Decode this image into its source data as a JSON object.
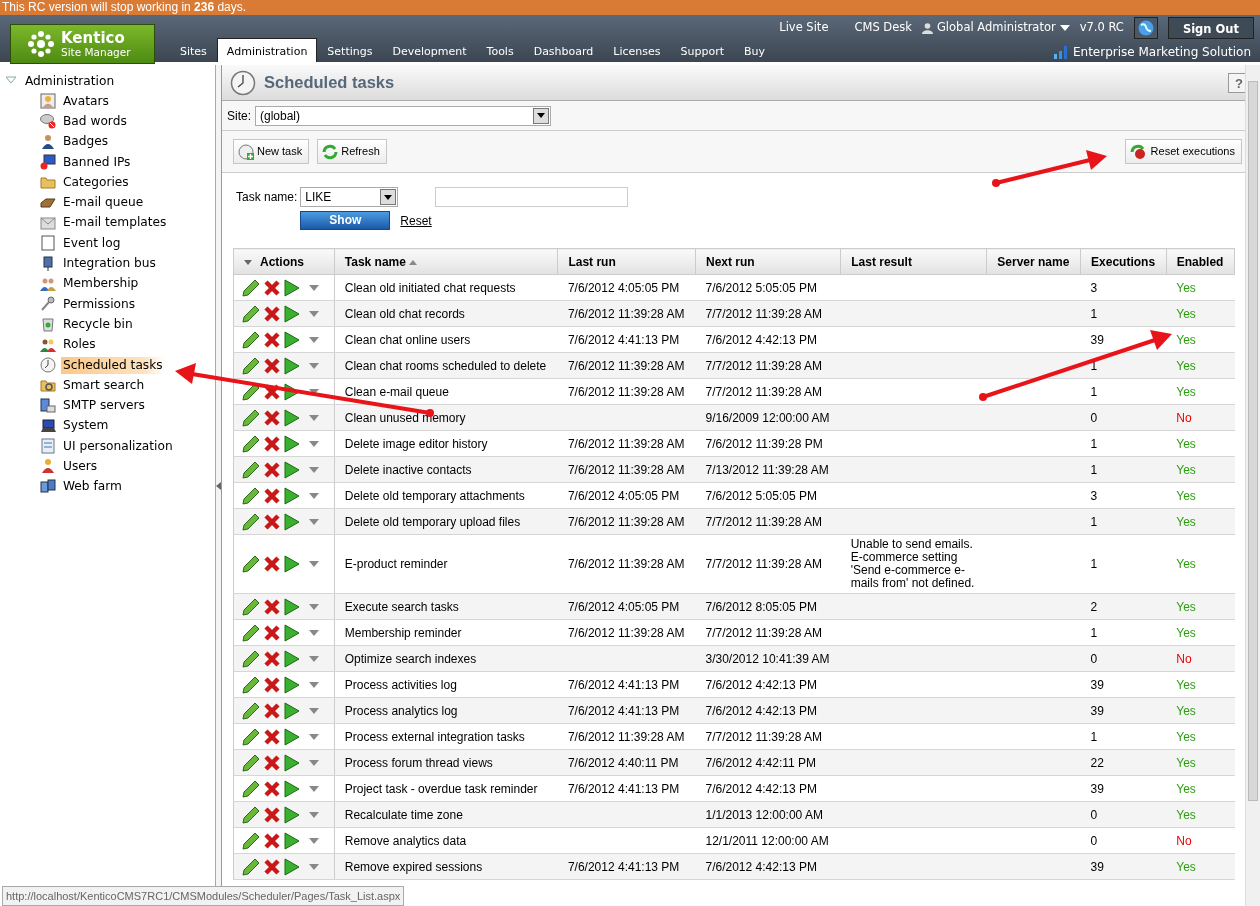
{
  "notice": "This RC version will stop working in **236** days.",
  "header": {
    "logo": {
      "name": "Kentico",
      "subtitle": "Site Manager"
    },
    "tabs": [
      {
        "label": "Sites",
        "selected": false
      },
      {
        "label": "Administration",
        "selected": true
      },
      {
        "label": "Settings",
        "selected": false
      },
      {
        "label": "Development",
        "selected": false
      },
      {
        "label": "Tools",
        "selected": false
      },
      {
        "label": "Dashboard",
        "selected": false
      },
      {
        "label": "Licenses",
        "selected": false
      },
      {
        "label": "Support",
        "selected": false
      },
      {
        "label": "Buy",
        "selected": false
      }
    ],
    "links": [
      "Live Site",
      "CMS Desk"
    ],
    "user": "Global Administrator",
    "version": "v7.0 RC",
    "sign_out": "Sign Out",
    "edition": "Enterprise Marketing Solution"
  },
  "sidebar": {
    "root": {
      "label": "Administration",
      "expanded": true,
      "children": [
        {
          "label": "Avatars",
          "selected": false
        },
        {
          "label": "Bad words",
          "selected": false
        },
        {
          "label": "Badges",
          "selected": false
        },
        {
          "label": "Banned IPs",
          "selected": false
        },
        {
          "label": "Categories",
          "selected": false
        },
        {
          "label": "E-mail queue",
          "selected": false
        },
        {
          "label": "E-mail templates",
          "selected": false
        },
        {
          "label": "Event log",
          "selected": false
        },
        {
          "label": "Integration bus",
          "selected": false
        },
        {
          "label": "Membership",
          "selected": false
        },
        {
          "label": "Permissions",
          "selected": false
        },
        {
          "label": "Recycle bin",
          "selected": false
        },
        {
          "label": "Roles",
          "selected": false
        },
        {
          "label": "Scheduled tasks",
          "selected": true
        },
        {
          "label": "Smart search",
          "selected": false
        },
        {
          "label": "SMTP servers",
          "selected": false
        },
        {
          "label": "System",
          "selected": false
        },
        {
          "label": "UI personalization",
          "selected": false
        },
        {
          "label": "Users",
          "selected": false
        },
        {
          "label": "Web farm",
          "selected": false
        }
      ]
    }
  },
  "page": {
    "title": "Scheduled tasks",
    "help": "?",
    "site": {
      "label": "Site:",
      "value": "(global)"
    },
    "toolbar": [
      "New task",
      "Refresh"
    ],
    "reset_executions": "Reset executions",
    "filter": {
      "label": "Task name:",
      "operator": "LIKE",
      "show": "Show",
      "reset": "Reset"
    },
    "table": {
      "columns": [
        {
          "label": "Actions"
        },
        {
          "label": "Task name",
          "sort_ascending": true
        },
        {
          "label": "Last run"
        },
        {
          "label": "Next run"
        },
        {
          "label": "Last result"
        },
        {
          "label": "Server name"
        },
        {
          "label": "Executions"
        },
        {
          "label": "Enabled"
        }
      ],
      "rows": [
        {
          "name": "Clean old initiated chat requests",
          "last_run": "7/6/2012 4:05:05 PM",
          "next_run": "7/6/2012 5:05:05 PM",
          "executions": "3",
          "enabled_text": "Yes",
          "enabled": true
        },
        {
          "name": "Clean old chat records",
          "last_run": "7/6/2012 11:39:28 AM",
          "next_run": "7/7/2012 11:39:28 AM",
          "executions": "1",
          "enabled_text": "Yes",
          "enabled": true
        },
        {
          "name": "Clean chat online users",
          "last_run": "7/6/2012 4:41:13 PM",
          "next_run": "7/6/2012 4:42:13 PM",
          "executions": "39",
          "enabled_text": "Yes",
          "enabled": true
        },
        {
          "name": "Clean chat rooms scheduled to delete",
          "last_run": "7/6/2012 11:39:28 AM",
          "next_run": "7/7/2012 11:39:28 AM",
          "executions": "1",
          "enabled_text": "Yes",
          "enabled": true
        },
        {
          "name": "Clean e-mail queue",
          "last_run": "7/6/2012 11:39:28 AM",
          "next_run": "7/7/2012 11:39:28 AM",
          "executions": "1",
          "enabled_text": "Yes",
          "enabled": true
        },
        {
          "name": "Clean unused memory",
          "next_run": "9/16/2009 12:00:00 AM",
          "executions": "0",
          "enabled_text": "No",
          "enabled": false
        },
        {
          "name": "Delete image editor history",
          "last_run": "7/6/2012 11:39:28 AM",
          "next_run": "7/6/2012 11:39:28 PM",
          "executions": "1",
          "enabled_text": "Yes",
          "enabled": true
        },
        {
          "name": "Delete inactive contacts",
          "last_run": "7/6/2012 11:39:28 AM",
          "next_run": "7/13/2012 11:39:28 AM",
          "executions": "1",
          "enabled_text": "Yes",
          "enabled": true
        },
        {
          "name": "Delete old temporary attachments",
          "last_run": "7/6/2012 4:05:05 PM",
          "next_run": "7/6/2012 5:05:05 PM",
          "executions": "3",
          "enabled_text": "Yes",
          "enabled": true
        },
        {
          "name": "Delete old temporary upload files",
          "last_run": "7/6/2012 11:39:28 AM",
          "next_run": "7/7/2012 11:39:28 AM",
          "executions": "1",
          "enabled_text": "Yes",
          "enabled": true
        },
        {
          "name": "E-product reminder",
          "last_run": "7/6/2012 11:39:28 AM",
          "next_run": "7/7/2012 11:39:28 AM",
          "last_result": "Unable to send emails. E-commerce setting 'Send e-commerce e-mails from' not defined.",
          "executions": "1",
          "enabled_text": "Yes",
          "enabled": true
        },
        {
          "name": "Execute search tasks",
          "last_run": "7/6/2012 4:05:05 PM",
          "next_run": "7/6/2012 8:05:05 PM",
          "executions": "2",
          "enabled_text": "Yes",
          "enabled": true
        },
        {
          "name": "Membership reminder",
          "last_run": "7/6/2012 11:39:28 AM",
          "next_run": "7/7/2012 11:39:28 AM",
          "executions": "1",
          "enabled_text": "Yes",
          "enabled": true
        },
        {
          "name": "Optimize search indexes",
          "next_run": "3/30/2012 10:41:39 AM",
          "executions": "0",
          "enabled_text": "No",
          "enabled": false
        },
        {
          "name": "Process activities log",
          "last_run": "7/6/2012 4:41:13 PM",
          "next_run": "7/6/2012 4:42:13 PM",
          "executions": "39",
          "enabled_text": "Yes",
          "enabled": true
        },
        {
          "name": "Process analytics log",
          "last_run": "7/6/2012 4:41:13 PM",
          "next_run": "7/6/2012 4:42:13 PM",
          "executions": "39",
          "enabled_text": "Yes",
          "enabled": true
        },
        {
          "name": "Process external integration tasks",
          "last_run": "7/6/2012 11:39:28 AM",
          "next_run": "7/7/2012 11:39:28 AM",
          "executions": "1",
          "enabled_text": "Yes",
          "enabled": true
        },
        {
          "name": "Process forum thread views",
          "last_run": "7/6/2012 4:40:11 PM",
          "next_run": "7/6/2012 4:42:11 PM",
          "executions": "22",
          "enabled_text": "Yes",
          "enabled": true
        },
        {
          "name": "Project task - overdue task reminder",
          "last_run": "7/6/2012 4:41:13 PM",
          "next_run": "7/6/2012 4:42:13 PM",
          "executions": "39",
          "enabled_text": "Yes",
          "enabled": true
        },
        {
          "name": "Recalculate time zone",
          "next_run": "1/1/2013 12:00:00 AM",
          "executions": "0",
          "enabled_text": "Yes",
          "enabled": true
        },
        {
          "name": "Remove analytics data",
          "next_run": "12/1/2011 12:00:00 AM",
          "executions": "0",
          "enabled_text": "No",
          "enabled": false
        },
        {
          "name": "Remove expired sessions",
          "last_run": "7/6/2012 4:41:13 PM",
          "next_run": "7/6/2012 4:42:13 PM",
          "executions": "39",
          "enabled_text": "Yes",
          "enabled": true
        }
      ]
    }
  },
  "status_url": "http://localhost/KenticoCMS7RC1/CMSModules/Scheduler/Pages/Task_List.aspx"
}
